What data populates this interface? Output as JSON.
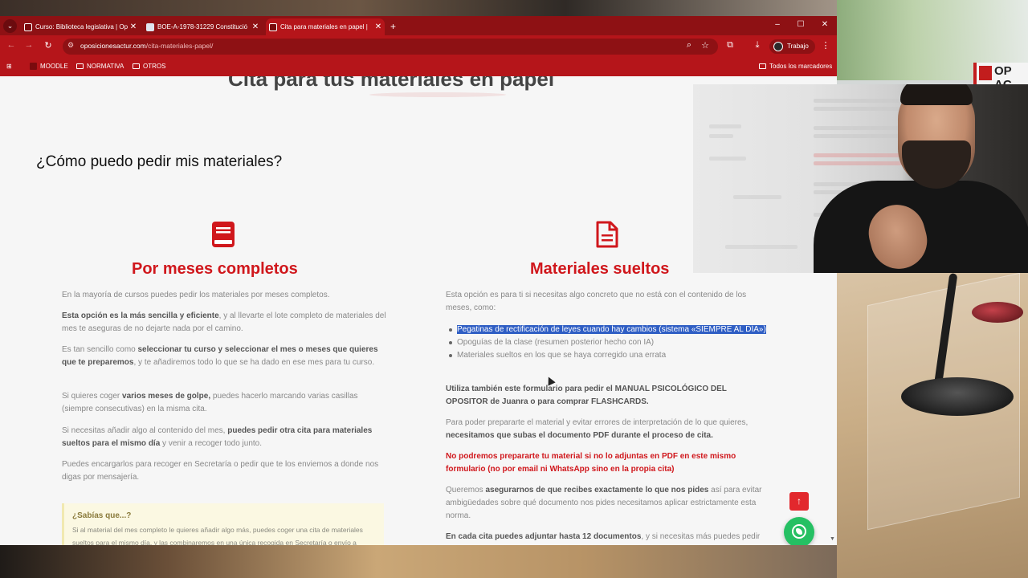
{
  "browser": {
    "tabs": [
      {
        "title": "Curso: Biblioteca legislativa | Op",
        "active": false
      },
      {
        "title": "BOE-A-1978-31229 Constitució",
        "active": false
      },
      {
        "title": "Cita para materiales en papel | ",
        "active": true
      }
    ],
    "url_domain": "oposicionesactur.com",
    "url_path": "/cita-materiales-papel/",
    "profile_label": "Trabajo",
    "bookmarks": [
      "MOODLE",
      "NORMATIVA",
      "OTROS"
    ],
    "all_bookmarks_label": "Todos los marcadores",
    "theme_color": "#b5151a"
  },
  "page": {
    "hero_title": "Cita para tus materiales en papel",
    "section_title": "¿Cómo puedo pedir mis materiales?",
    "accent_color": "#d0171c",
    "left": {
      "icon": "book-icon",
      "title": "Por meses completos",
      "p1": "En la mayoría de cursos puedes pedir los materiales por meses completos.",
      "p2_bold": "Esta opción es la más sencilla y eficiente",
      "p2_rest": ", y al llevarte el lote completo de materiales del mes te aseguras de no dejarte nada por el camino.",
      "p3_a": "Es tan sencillo como ",
      "p3_bold": "seleccionar tu curso y seleccionar el mes o meses que quieres que te preparemos",
      "p3_b": ", y te añadiremos todo lo que se ha dado en ese mes para tu curso.",
      "p4_a": "Si quieres coger ",
      "p4_bold": "varios meses de golpe,",
      "p4_b": " puedes hacerlo marcando varias casillas (siempre consecutivas) en la misma cita.",
      "p5_a": "Si necesitas añadir algo al contenido del mes, ",
      "p5_bold": "puedes pedir otra cita para materiales sueltos para el mismo día",
      "p5_b": " y venir a recoger todo junto.",
      "p6": "Puedes encargarlos para recoger en Secretaría o pedir que te los enviemos a donde nos digas por mensajería.",
      "tip_title": "¿Sabías que...?",
      "tip_text": "Si al material del mes completo le quieres añadir algo más, puedes coger una cita de materiales sueltos para el mismo día, y las combinaremos en una única recogida en Secretaría o envío a domicilio."
    },
    "right": {
      "icon": "document-icon",
      "title": "Materiales sueltos",
      "intro": "Esta opción es para ti si necesitas algo concreto que no está con el contenido de los meses, como:",
      "bullets": [
        "Pegatinas de rectificación de leyes cuando hay cambios (sistema «SIEMPRE AL DÍA»)",
        "Opoguías de la clase (resumen posterior hecho con IA)",
        "Materiales sueltos en los que se haya corregido una errata"
      ],
      "p_manual": "Utiliza también este formulario para pedir el MANUAL PSICOLÓGICO DEL OPOSITOR de Juanra o para comprar FLASHCARDS.",
      "p_pdf_a": "Para poder prepararte el material y evitar errores de interpretación de lo que quieres, ",
      "p_pdf_bold": "necesitamos que subas el documento PDF durante el proceso de cita.",
      "p_warning": "No podremos prepararte tu material si no lo adjuntas en PDF en este mismo formulario (no por email ni WhatsApp sino en la propia cita)",
      "p_ensure_a": "Queremos ",
      "p_ensure_bold": "asegurarnos de que recibes exactamente lo que nos pides",
      "p_ensure_b": " así para evitar ambigüedades sobre qué documento nos pides necesitamos aplicar estrictamente esta norma.",
      "p_docs_bold": "En cada cita puedes adjuntar hasta 12 documentos",
      "p_docs_rest": ", y si necesitas más puedes pedir varias citas para el mismo día y te las prepararemos juntas."
    },
    "scroll_top_icon": "arrow-up-icon",
    "whatsapp_icon": "whatsapp-icon"
  },
  "scene": {
    "logo_text": "OP AC"
  }
}
